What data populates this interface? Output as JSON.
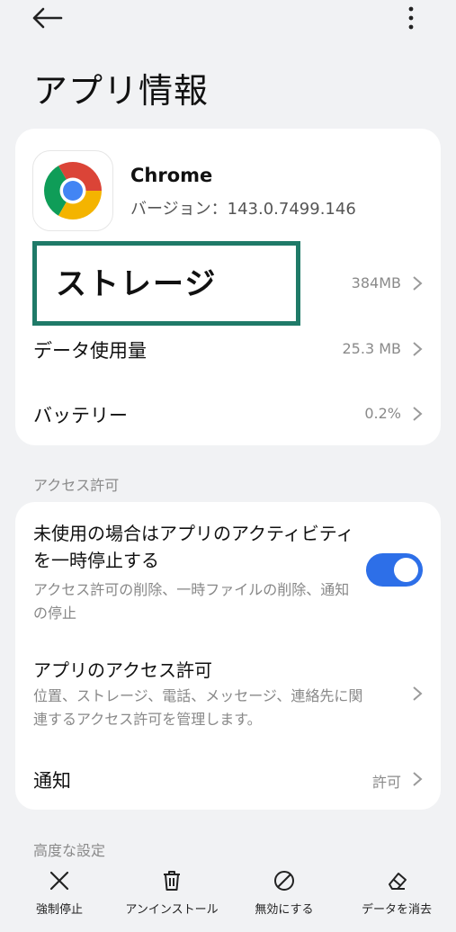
{
  "page": {
    "title": "アプリ情報"
  },
  "app": {
    "name": "Chrome",
    "version": "バージョン：143.0.7499.146"
  },
  "rows": {
    "storage": {
      "label": "ストレージ",
      "value": "384MB"
    },
    "data_usage": {
      "label": "データ使用量",
      "value": "25.3 MB"
    },
    "battery": {
      "label": "バッテリー",
      "value": "0.2%"
    }
  },
  "sections": {
    "access": "アクセス許可",
    "advanced": "高度な設定"
  },
  "permissions": {
    "pause_when_unused": {
      "title": "未使用の場合はアプリのアクティビティを一時停止する",
      "subtitle": "アクセス許可の削除、一時ファイルの削除、通知の停止",
      "enabled": true
    },
    "app_permissions": {
      "title": "アプリのアクセス許可",
      "subtitle": "位置、ストレージ、電話、メッセージ、連絡先に関連するアクセス許可を管理します。"
    },
    "notifications": {
      "label": "通知",
      "value": "許可"
    }
  },
  "bottom_bar": {
    "force_stop": "強制停止",
    "uninstall": "アンインストール",
    "disable": "無効にする",
    "clear_data": "データを消去"
  },
  "colors": {
    "accent": "#2d6fe8",
    "highlight_border": "#1f7a68",
    "background": "#f1f2f4"
  }
}
